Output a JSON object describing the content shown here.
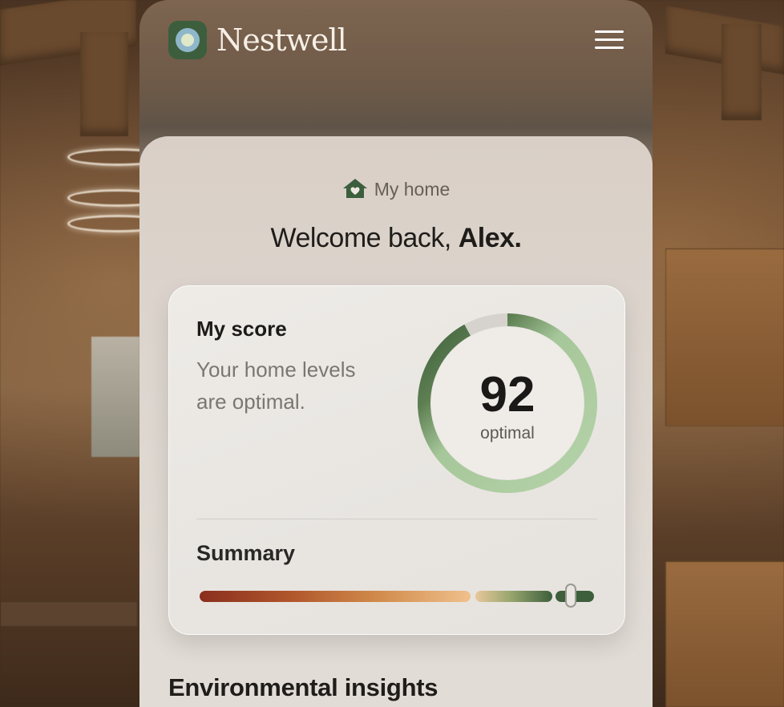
{
  "header": {
    "brand": "Nestwell"
  },
  "home": {
    "label": "My home",
    "welcome_prefix": "Welcome back, ",
    "welcome_name": "Alex."
  },
  "score_card": {
    "title": "My score",
    "description": "Your home levels are optimal.",
    "score_value": "92",
    "score_label": "optimal",
    "score_fraction": 0.92,
    "summary_title": "Summary",
    "summary_position_fraction": 0.9
  },
  "sections": {
    "insights_title": "Environmental insights"
  },
  "colors": {
    "brand_green": "#3c5e3c",
    "gauge_light": "#b6d3a9",
    "gauge_dark": "#3d5f3c",
    "bar_start": "#8a2f1e",
    "bar_mid": "#c77b3e",
    "bar_light": "#f0c08c"
  }
}
